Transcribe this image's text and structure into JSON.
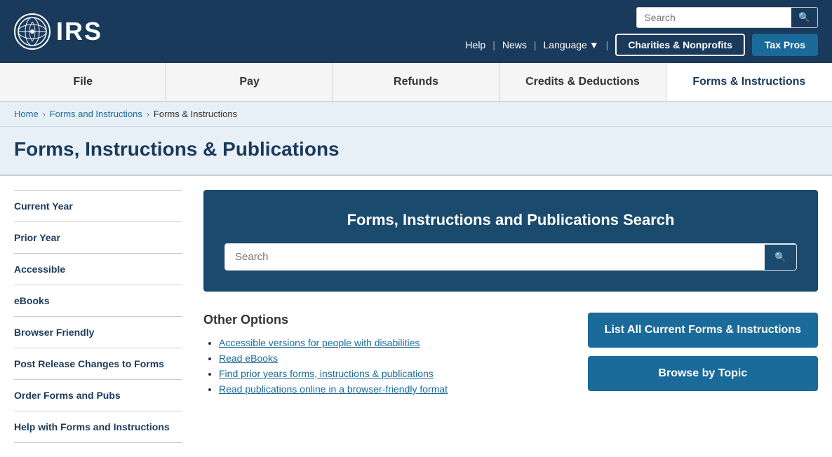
{
  "header": {
    "logo_text": "IRS",
    "search_placeholder": "Search",
    "nav": {
      "help": "Help",
      "news": "News",
      "language": "Language",
      "charities_btn": "Charities & Nonprofits",
      "taxpros_btn": "Tax Pros"
    }
  },
  "main_nav": {
    "items": [
      {
        "label": "File",
        "active": false
      },
      {
        "label": "Pay",
        "active": false
      },
      {
        "label": "Refunds",
        "active": false
      },
      {
        "label": "Credits & Deductions",
        "active": false
      },
      {
        "label": "Forms & Instructions",
        "active": true
      }
    ]
  },
  "breadcrumb": {
    "home": "Home",
    "forms_instructions": "Forms and Instructions",
    "current": "Forms & Instructions"
  },
  "page_title": "Forms, Instructions & Publications",
  "sidebar": {
    "items": [
      {
        "label": "Current Year"
      },
      {
        "label": "Prior Year"
      },
      {
        "label": "Accessible"
      },
      {
        "label": "eBooks"
      },
      {
        "label": "Browser Friendly"
      },
      {
        "label": "Post Release Changes to Forms"
      },
      {
        "label": "Order Forms and Pubs"
      },
      {
        "label": "Help with Forms and Instructions"
      }
    ]
  },
  "search_panel": {
    "title": "Forms, Instructions and Publications Search",
    "placeholder": "Search"
  },
  "other_options": {
    "heading": "Other Options",
    "links": [
      {
        "text": "Accessible versions for people with disabilities",
        "href": "#"
      },
      {
        "text": "Read eBooks",
        "href": "#"
      },
      {
        "text": "Find prior years forms, instructions & publications",
        "href": "#"
      },
      {
        "text": "Read publications online in a browser-friendly format",
        "href": "#"
      }
    ],
    "buttons": [
      {
        "label": "List All Current Forms & Instructions"
      },
      {
        "label": "Browse by Topic"
      }
    ]
  }
}
